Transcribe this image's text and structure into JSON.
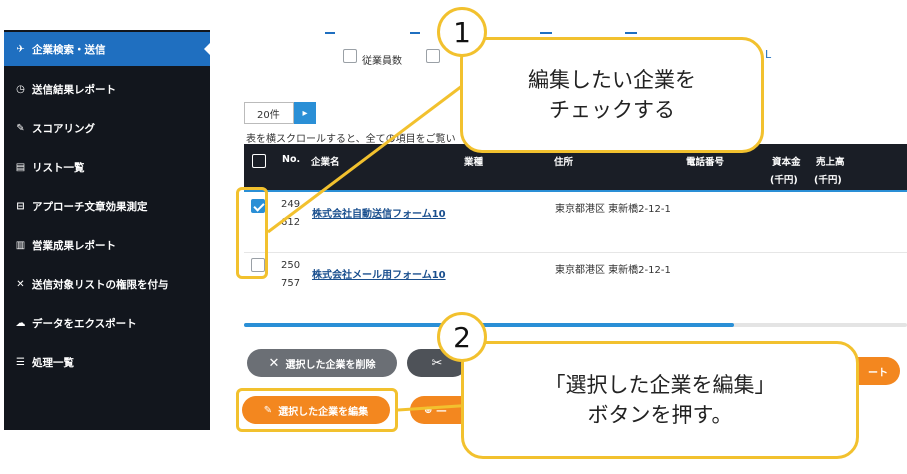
{
  "sidebar": {
    "items": [
      {
        "label": "企業検索・送信",
        "icon": "send-icon"
      },
      {
        "label": "送信結果レポート",
        "icon": "clock-icon"
      },
      {
        "label": "スコアリング",
        "icon": "pen-icon"
      },
      {
        "label": "リスト一覧",
        "icon": "document-icon"
      },
      {
        "label": "アプローチ文章効果測定",
        "icon": "edit-icon"
      },
      {
        "label": "営業成果レポート",
        "icon": "bar-chart-icon"
      },
      {
        "label": "送信対象リストの権限を付与",
        "icon": "tools-icon"
      },
      {
        "label": "データをエクスポート",
        "icon": "cloud-upload-icon"
      },
      {
        "label": "処理一覧",
        "icon": "list-icon"
      }
    ]
  },
  "filters": {
    "employees_label": "従業員数",
    "link_fragment": "L"
  },
  "pagination": {
    "per_page": "20件",
    "go": "▸"
  },
  "hint": "表を横スクロールすると、全ての項目をご覧い",
  "table": {
    "headers": {
      "no": "No.",
      "company": "企業名",
      "industry": "業種",
      "address": "住所",
      "phone": "電話番号",
      "capital": "資本金",
      "capital_unit": "(千円)",
      "sales": "売上高",
      "sales_unit": "(千円)"
    },
    "rows": [
      {
        "no_1": "249",
        "no_2": "612",
        "company": "株式会社自動送信フォーム10",
        "address": "東京都港区 東新橋2-12-1",
        "checked": true
      },
      {
        "no_1": "250",
        "no_2": "757",
        "company": "株式会社メール用フォーム10",
        "address": "東京都港区 東新橋2-12-1",
        "checked": false
      }
    ]
  },
  "buttons": {
    "delete_selected": "選択した企業を削除",
    "edit_selected": "選択した企業を編集",
    "add_fragment": "一",
    "export_fragment": "ート"
  },
  "callouts": {
    "step1_number": "1",
    "step1_text": "編集したい企業を\nチェックする",
    "step2_number": "2",
    "step2_text": "「選択した企業を編集」\nボタンを押す。"
  },
  "colors": {
    "accent_blue": "#1f6fc0",
    "highlight_yellow": "#f2c12e",
    "orange": "#f3871f",
    "sidebar_bg": "#12161d"
  }
}
